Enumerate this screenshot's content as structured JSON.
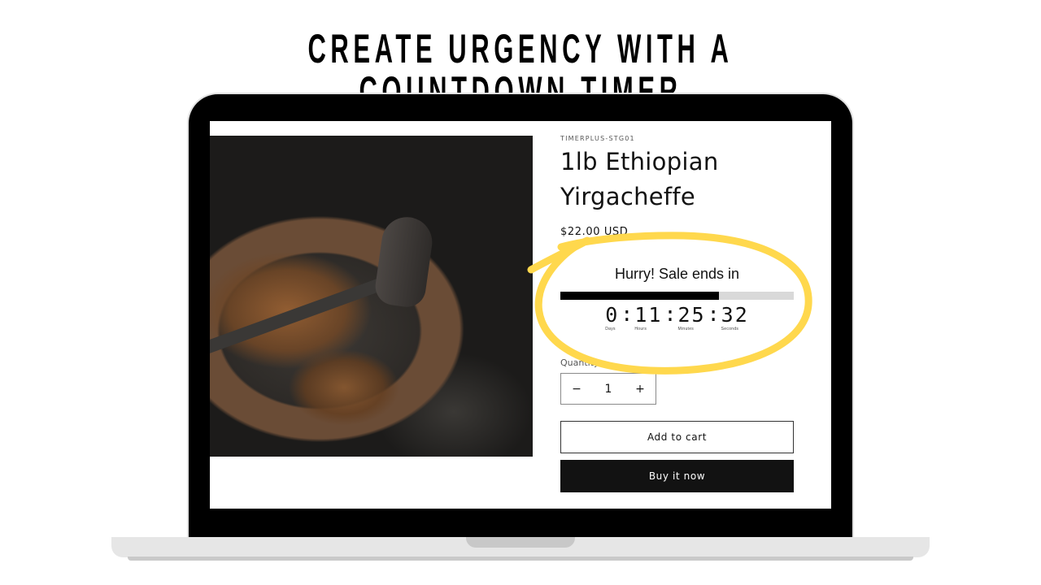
{
  "headline": "CREATE URGENCY WITH A COUNTDOWN TIMER",
  "product": {
    "image_alt": "coffee-beans-roasting-pan",
    "sku": "TIMERPLUS-STG01",
    "title": "1lb Ethiopian Yirgacheffe",
    "price": "$22.00 USD"
  },
  "timer": {
    "heading": "Hurry! Sale ends in",
    "progress_fraction": 0.68,
    "colors": {
      "fill": "#000000",
      "track": "#d9d9d9"
    },
    "units": [
      {
        "value": "0",
        "label": "Days"
      },
      {
        "value": "11",
        "label": "Hours"
      },
      {
        "value": "25",
        "label": "Minutes"
      },
      {
        "value": "32",
        "label": "Seconds"
      }
    ],
    "separator": ":"
  },
  "quantity": {
    "label": "Quantity",
    "value": "1",
    "decrease_symbol": "−",
    "increase_symbol": "+"
  },
  "buttons": {
    "add_to_cart": "Add to cart",
    "buy_now": "Buy it now"
  },
  "annotation": {
    "highlight_color": "#ffd84d"
  }
}
